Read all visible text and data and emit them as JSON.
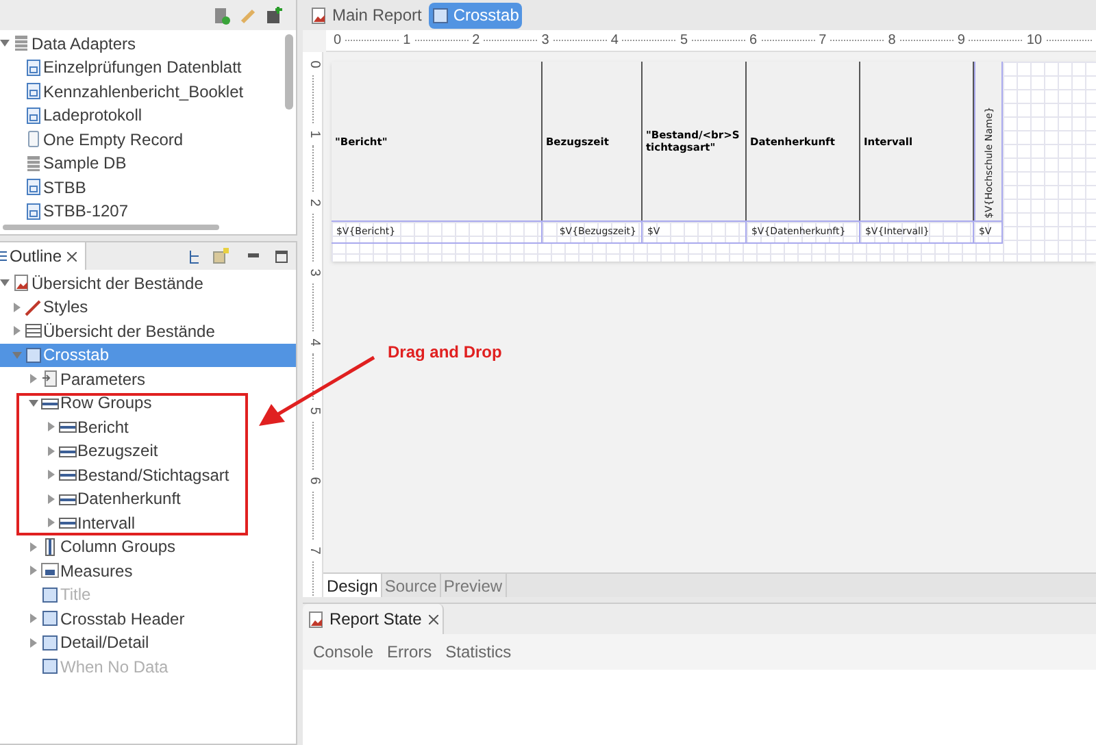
{
  "data_adapters": {
    "tree": [
      {
        "label": "Data Adapters",
        "kind": "database",
        "expanded": true,
        "children": [
          {
            "label": "Einzelprüfungen Datenblatt",
            "kind": "adapter"
          },
          {
            "label": "Kennzahlenbericht_Booklet",
            "kind": "adapter"
          },
          {
            "label": "Ladeprotokoll",
            "kind": "adapter"
          },
          {
            "label": "One Empty Record",
            "kind": "empty"
          },
          {
            "label": "Sample DB",
            "kind": "database"
          },
          {
            "label": "STBB",
            "kind": "adapter"
          },
          {
            "label": "STBB-1207",
            "kind": "adapter"
          }
        ]
      }
    ]
  },
  "outline": {
    "title": "Outline",
    "tree": [
      {
        "label": "Übersicht der Bestände",
        "kind": "report",
        "expanded": true,
        "selected": false,
        "disabled": false,
        "children": [
          {
            "label": "Styles",
            "kind": "styles",
            "expanded": false,
            "selected": false,
            "disabled": false
          },
          {
            "label": "Übersicht der Bestände",
            "kind": "table",
            "expanded": false,
            "selected": false,
            "disabled": false
          },
          {
            "label": "Crosstab",
            "kind": "cell",
            "expanded": true,
            "selected": true,
            "disabled": false,
            "children": [
              {
                "label": "Parameters",
                "kind": "parameters",
                "expanded": false,
                "selected": false,
                "disabled": false
              },
              {
                "label": "Row Groups",
                "kind": "group",
                "expanded": true,
                "selected": false,
                "disabled": false,
                "children": [
                  {
                    "label": "Bericht",
                    "kind": "group",
                    "expanded": false,
                    "selected": false,
                    "disabled": false
                  },
                  {
                    "label": "Bezugszeit",
                    "kind": "group",
                    "expanded": false,
                    "selected": false,
                    "disabled": false
                  },
                  {
                    "label": "Bestand/Stichtagsart",
                    "kind": "group",
                    "expanded": false,
                    "selected": false,
                    "disabled": false
                  },
                  {
                    "label": "Datenherkunft",
                    "kind": "group",
                    "expanded": false,
                    "selected": false,
                    "disabled": false
                  },
                  {
                    "label": "Intervall",
                    "kind": "group",
                    "expanded": false,
                    "selected": false,
                    "disabled": false
                  }
                ]
              },
              {
                "label": "Column Groups",
                "kind": "column-group",
                "expanded": false,
                "selected": false,
                "disabled": false
              },
              {
                "label": "Measures",
                "kind": "measures",
                "expanded": false,
                "selected": false,
                "disabled": false
              },
              {
                "label": "Title",
                "kind": "cell",
                "selected": false,
                "disabled": true
              },
              {
                "label": "Crosstab Header",
                "kind": "cell",
                "expanded": false,
                "selected": false,
                "disabled": false
              },
              {
                "label": "Detail/Detail",
                "kind": "cell",
                "expanded": false,
                "selected": false,
                "disabled": false
              },
              {
                "label": "When No Data",
                "kind": "cell",
                "selected": false,
                "disabled": true
              }
            ]
          }
        ]
      }
    ]
  },
  "annotation": {
    "label": "Drag and Drop"
  },
  "editor": {
    "tabs": [
      {
        "label": "Main Report",
        "kind": "report",
        "selected": false
      },
      {
        "label": "Crosstab",
        "kind": "cell",
        "selected": true
      }
    ],
    "ruler_h": [
      "0",
      "1",
      "2",
      "3",
      "4",
      "5",
      "6",
      "7",
      "8",
      "9",
      "10"
    ],
    "ruler_v": [
      "0",
      "1",
      "2",
      "3",
      "4",
      "5",
      "6",
      "7"
    ],
    "crosstab": {
      "headers": [
        "\"Bericht\"",
        "Bezugszeit",
        "\"Bestand/<br>Stichtagsart\"",
        "Datenherkunft",
        "Intervall"
      ],
      "vertical_header": "$V{Hochschule Name}",
      "cells": [
        "$V{Bericht}",
        "$V{Bezugszeit}",
        "$V",
        "$V{Datenherkunft}",
        "$V{Intervall}",
        "$V"
      ]
    },
    "view_tabs": [
      {
        "label": "Design",
        "selected": true
      },
      {
        "label": "Source",
        "selected": false
      },
      {
        "label": "Preview",
        "selected": false
      }
    ]
  },
  "report_state": {
    "title": "Report State",
    "tabs": [
      "Console",
      "Errors",
      "Statistics"
    ]
  }
}
